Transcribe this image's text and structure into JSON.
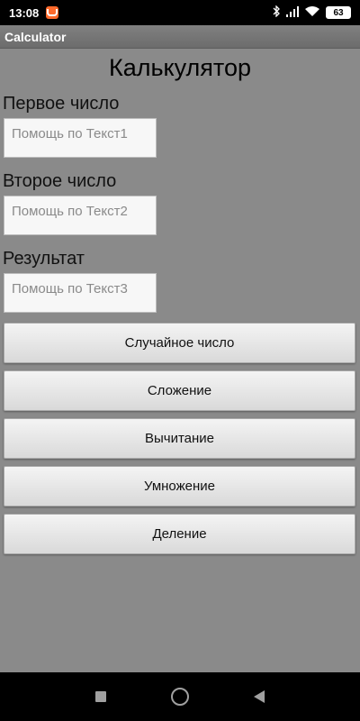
{
  "status_bar": {
    "time": "13:08",
    "battery": "63",
    "icons": [
      "bluetooth-icon",
      "signal-icon",
      "wifi-icon",
      "battery-icon"
    ]
  },
  "app": {
    "title": "Calculator"
  },
  "main": {
    "heading": "Калькулятор",
    "fields": [
      {
        "label": "Первое число",
        "placeholder": "Помощь по Текст1"
      },
      {
        "label": "Второе число",
        "placeholder": "Помощь по Текст2"
      },
      {
        "label": "Результат",
        "placeholder": "Помощь по Текст3"
      }
    ],
    "buttons": {
      "random": "Случайное число",
      "add": "Сложение",
      "subtract": "Вычитание",
      "multiply": "Умножение",
      "divide": "Деление"
    }
  },
  "nav_bar": {
    "icons": [
      "recents-square-icon",
      "home-circle-icon",
      "back-triangle-icon"
    ]
  },
  "colors": {
    "background": "#8a8a8a",
    "title_bar": "#777777",
    "button_face": "#e8e8e8",
    "status_bar": "#000000"
  }
}
